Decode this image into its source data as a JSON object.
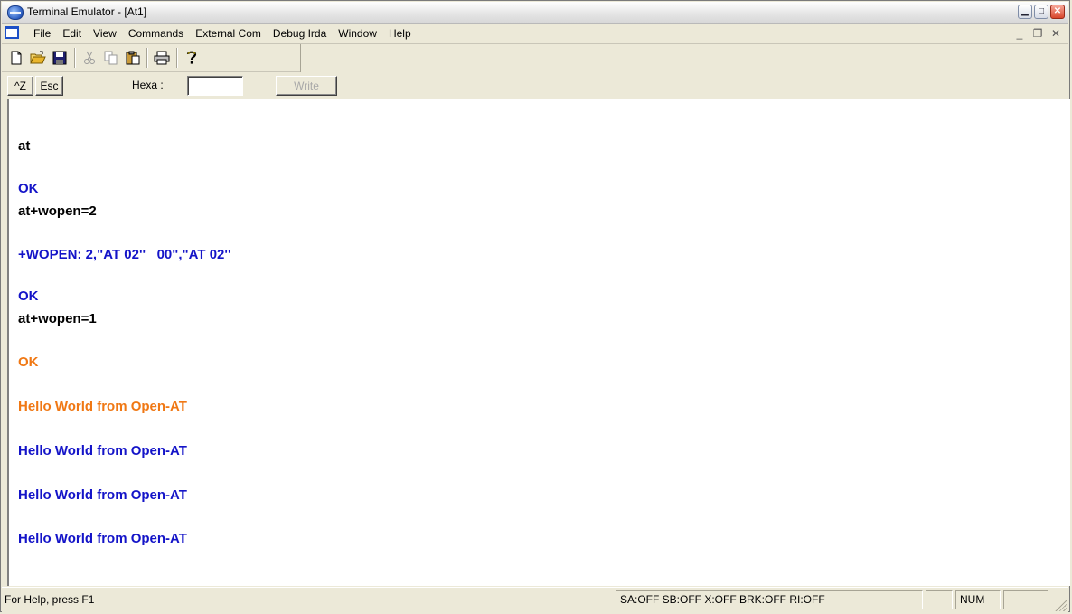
{
  "window": {
    "title": "Terminal Emulator - [At1]"
  },
  "menubar": {
    "items": [
      "File",
      "Edit",
      "View",
      "Commands",
      "External Com",
      "Debug Irda",
      "Window",
      "Help"
    ]
  },
  "toolbar": {
    "icons": [
      "new-document-icon",
      "open-folder-icon",
      "save-icon",
      "cut-icon",
      "copy-icon",
      "paste-icon",
      "print-icon",
      "help-icon"
    ]
  },
  "hexbar": {
    "ctrl_z_label": "^Z",
    "esc_label": "Esc",
    "hexa_label": "Hexa :",
    "hexa_value": "",
    "write_label": "Write"
  },
  "terminal": {
    "colors": {
      "command": "#000000",
      "response": "#1414c8",
      "highlight": "#f07814"
    },
    "lines": [
      {
        "text": "at",
        "color": "#000000"
      },
      {
        "text": "OK",
        "color": "#1414c8"
      },
      {
        "text": "at+wopen=2",
        "color": "#000000"
      },
      {
        "text": "+WOPEN: 2,\"AT 02''   00\",\"AT 02''",
        "color": "#1414c8"
      },
      {
        "text": "OK",
        "color": "#1414c8"
      },
      {
        "text": "at+wopen=1",
        "color": "#000000"
      },
      {
        "text": "OK",
        "color": "#f07814"
      },
      {
        "text": "Hello World from Open-AT",
        "color": "#f07814"
      },
      {
        "text": "Hello World from Open-AT",
        "color": "#1414c8"
      },
      {
        "text": "Hello World from Open-AT",
        "color": "#1414c8"
      },
      {
        "text": "Hello World from Open-AT",
        "color": "#1414c8"
      }
    ]
  },
  "statusbar": {
    "help_text": "For Help, press F1",
    "indicators": "SA:OFF  SB:OFF  X:OFF  BRK:OFF  RI:OFF",
    "num": "NUM"
  }
}
